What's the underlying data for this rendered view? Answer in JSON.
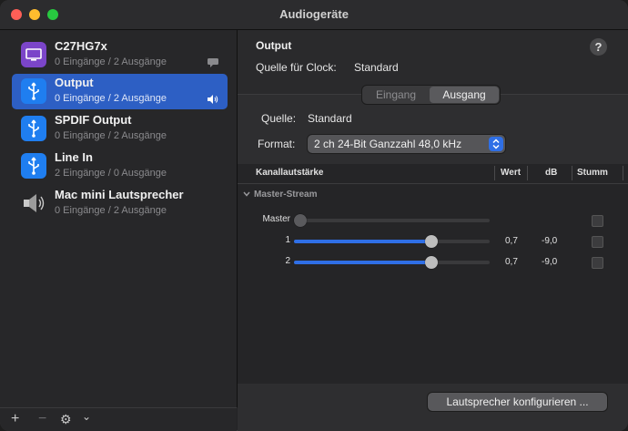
{
  "window": {
    "title": "Audiogeräte"
  },
  "devices": [
    {
      "name": "C27HG7x",
      "sub": "0 Eingänge / 2 Ausgänge",
      "icon": "monitor-icon",
      "badge": "message-icon",
      "selected": false
    },
    {
      "name": "Output",
      "sub": "0 Eingänge / 2 Ausgänge",
      "icon": "usb-icon",
      "badge": "speaker-icon",
      "selected": true
    },
    {
      "name": "SPDIF Output",
      "sub": "0 Eingänge / 2 Ausgänge",
      "icon": "usb-icon",
      "selected": false
    },
    {
      "name": "Line In",
      "sub": "2 Eingänge / 0 Ausgänge",
      "icon": "usb-icon",
      "selected": false
    },
    {
      "name": "Mac mini Lautsprecher",
      "sub": "0 Eingänge / 2 Ausgänge",
      "icon": "speaker-icon",
      "selected": false
    }
  ],
  "footer": {
    "add": "+",
    "remove": "−",
    "gear": "⚙",
    "chevron": "⌄"
  },
  "detail": {
    "title": "Output",
    "clock_label": "Quelle für Clock:",
    "clock_value": "Standard",
    "help": "?",
    "tabs": [
      "Eingang",
      "Ausgang"
    ],
    "active_tab": "Ausgang",
    "source_label": "Quelle:",
    "source_value": "Standard",
    "format_label": "Format:",
    "format_value": "2 ch 24-Bit Ganzzahl 48,0 kHz"
  },
  "table": {
    "headers": {
      "channel": "Kanallautstärke",
      "value": "Wert",
      "db": "dB",
      "mute": "Stumm"
    },
    "group": "Master-Stream",
    "rows": [
      {
        "label": "Master",
        "value": "",
        "db": "",
        "level": 0.0,
        "muted": false
      },
      {
        "label": "1",
        "value": "0,7",
        "db": "-9,0",
        "level": 0.7,
        "muted": false
      },
      {
        "label": "2",
        "value": "0,7",
        "db": "-9,0",
        "level": 0.7,
        "muted": false
      }
    ]
  },
  "configure_button": "Lautsprecher konfigurieren ...",
  "colors": {
    "accent": "#2f6fe6",
    "selection": "#2d5fc4",
    "close": "#ff5f57",
    "minimize": "#febc2e",
    "maximize": "#28c840"
  }
}
